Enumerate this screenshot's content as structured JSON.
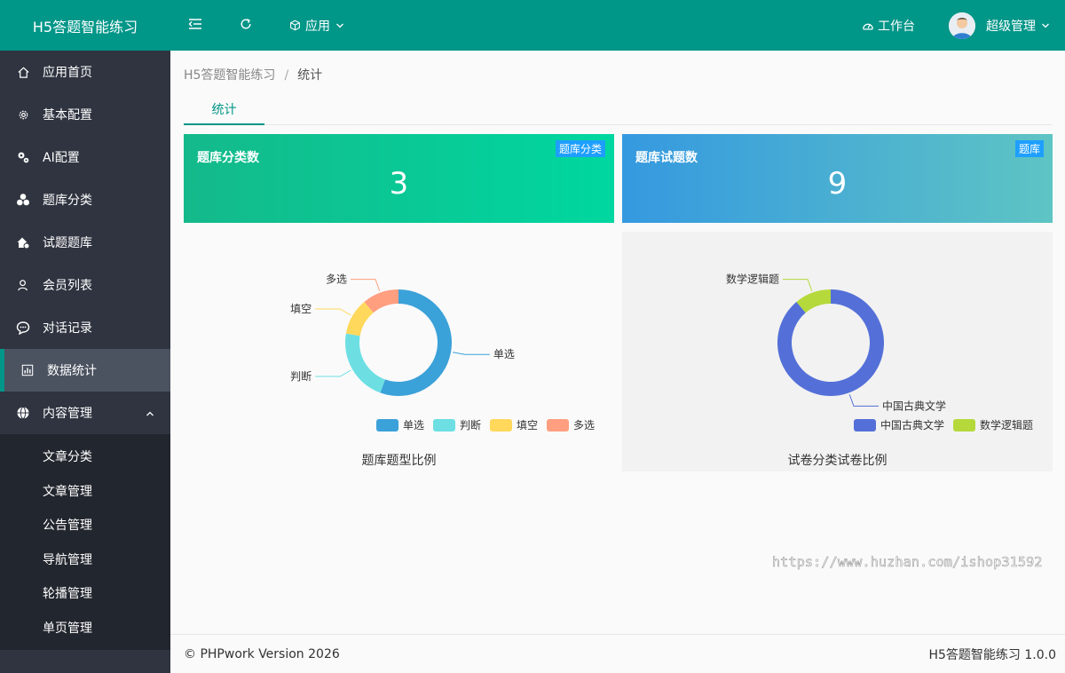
{
  "app": {
    "title": "H5答题智能练习"
  },
  "sidebar": {
    "items": [
      {
        "label": "应用首页",
        "icon": "home-icon"
      },
      {
        "label": "基本配置",
        "icon": "gear-icon"
      },
      {
        "label": "AI配置",
        "icon": "gears-icon"
      },
      {
        "label": "题库分类",
        "icon": "cluster-icon"
      },
      {
        "label": "试题题库",
        "icon": "house-gear-icon"
      },
      {
        "label": "会员列表",
        "icon": "user-icon"
      },
      {
        "label": "对话记录",
        "icon": "chat-icon"
      },
      {
        "label": "数据统计",
        "icon": "chart-icon",
        "active": true
      },
      {
        "label": "内容管理",
        "icon": "globe-icon",
        "expanded": true
      }
    ],
    "submenu": [
      {
        "label": "文章分类"
      },
      {
        "label": "文章管理"
      },
      {
        "label": "公告管理"
      },
      {
        "label": "导航管理"
      },
      {
        "label": "轮播管理"
      },
      {
        "label": "单页管理"
      }
    ]
  },
  "header": {
    "apps_label": "应用",
    "workbench_label": "工作台",
    "user_name": "超级管理"
  },
  "breadcrumb": {
    "root": "H5答题智能练习",
    "separator": "/",
    "current": "统计"
  },
  "tabs": [
    {
      "label": "统计"
    }
  ],
  "cards": [
    {
      "title": "题库分类数",
      "badge": "题库分类",
      "value": "3"
    },
    {
      "title": "题库试题数",
      "badge": "题库",
      "value": "9"
    }
  ],
  "chart_data": [
    {
      "type": "pie",
      "title": "题库题型比例",
      "categories": [
        "单选",
        "判断",
        "填空",
        "多选"
      ],
      "values": [
        5,
        2,
        1,
        1
      ],
      "colors": [
        "#3ba1d9",
        "#6ddfe3",
        "#ffd85c",
        "#ff9f7f"
      ],
      "legend": "bottom-right"
    },
    {
      "type": "pie",
      "title": "试卷分类试卷比例",
      "categories": [
        "中国古典文学",
        "数学逻辑题"
      ],
      "values": [
        8,
        1
      ],
      "colors": [
        "#5470d8",
        "#b5d93b"
      ],
      "legend": "bottom-right"
    }
  ],
  "watermark": "https://www.huzhan.com/ishop31592",
  "footer": {
    "copyright": "© PHPwork Version 2026",
    "version": "H5答题智能练习 1.0.0"
  },
  "colors": {
    "brand": "#009688",
    "sidebar": "#2f3440",
    "submenu": "#22262e",
    "badge": "#1e9fff"
  }
}
